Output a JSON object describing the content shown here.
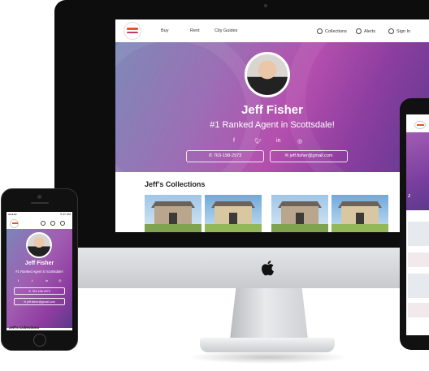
{
  "desktop": {
    "nav": {
      "links": [
        "Buy",
        "Rent",
        "City Guides"
      ],
      "right": [
        "Collections",
        "Alerts",
        "Sign In"
      ]
    },
    "agent": {
      "name": "Jeff Fisher",
      "tagline": "#1 Ranked Agent in Scottsdale!",
      "phone": "763-198-2973",
      "email": "jeff.fisher@gmail.com"
    },
    "social_icons": [
      "facebook-icon",
      "twitter-icon",
      "linkedin-icon",
      "instagram-icon"
    ],
    "collections_title": "Jeff’s Collections"
  },
  "mobile": {
    "status_time": "9:41 AM",
    "agent": {
      "name": "Jeff Fisher",
      "tagline": "#1 Ranked Agent in Scottsdale!",
      "phone": "763-198-2973",
      "email": "jeff.fisher@gmail.com"
    },
    "collections_title": "Jeff’s Collections"
  },
  "colors": {
    "hero_start": "#7e89b8",
    "hero_mid": "#b54fae",
    "hero_end": "#5e3a8e",
    "logo_accent": "#e2572b"
  }
}
